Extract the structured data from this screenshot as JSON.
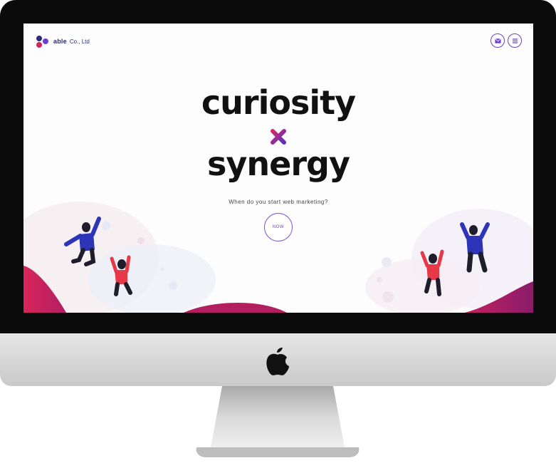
{
  "header": {
    "brand": "able",
    "brand_suffix": "Co., Ltd",
    "mail_icon": "mail-icon",
    "menu_icon": "menu-icon"
  },
  "hero": {
    "line1": "curiosity",
    "separator": "×",
    "line2": "synergy",
    "tagline": "When do you start web marketing?",
    "cta_label": "NOW"
  },
  "colors": {
    "brand_navy": "#2c2a7a",
    "accent_purple": "#6a3fd0",
    "accent_magenta": "#d1245a",
    "wave_pink": "#e8edf5"
  },
  "device": {
    "logo_icon": "apple-logo-icon"
  }
}
